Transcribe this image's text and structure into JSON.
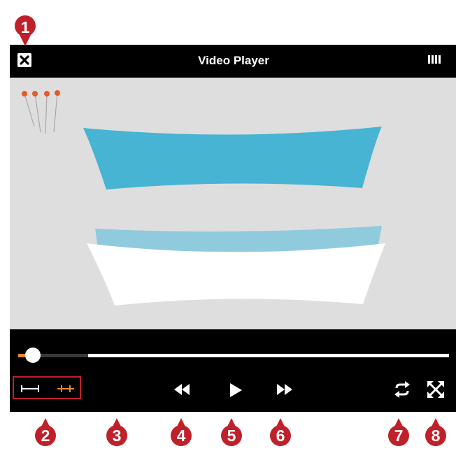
{
  "window": {
    "title": "Video Player"
  },
  "icons": {
    "close": "close-icon",
    "signal": "signal-icon",
    "ab_start": "ab-loop-start-icon",
    "ab_end": "ab-loop-end-icon",
    "rewind": "rewind-icon",
    "play": "play-icon",
    "fast_forward": "fast-forward-icon",
    "repeat": "repeat-icon",
    "fullscreen": "fullscreen-icon"
  },
  "playback": {
    "progress_fraction": 0.03
  },
  "callouts": [
    "1",
    "2",
    "3",
    "4",
    "5",
    "6",
    "7",
    "8"
  ],
  "colors": {
    "callout": "#c0202a",
    "accent": "#e8872e",
    "bar": "#000000",
    "video_bg": "#dedede",
    "fabric_blue": "#46b4d2",
    "fabric_light_blue": "#8fcbdd"
  }
}
